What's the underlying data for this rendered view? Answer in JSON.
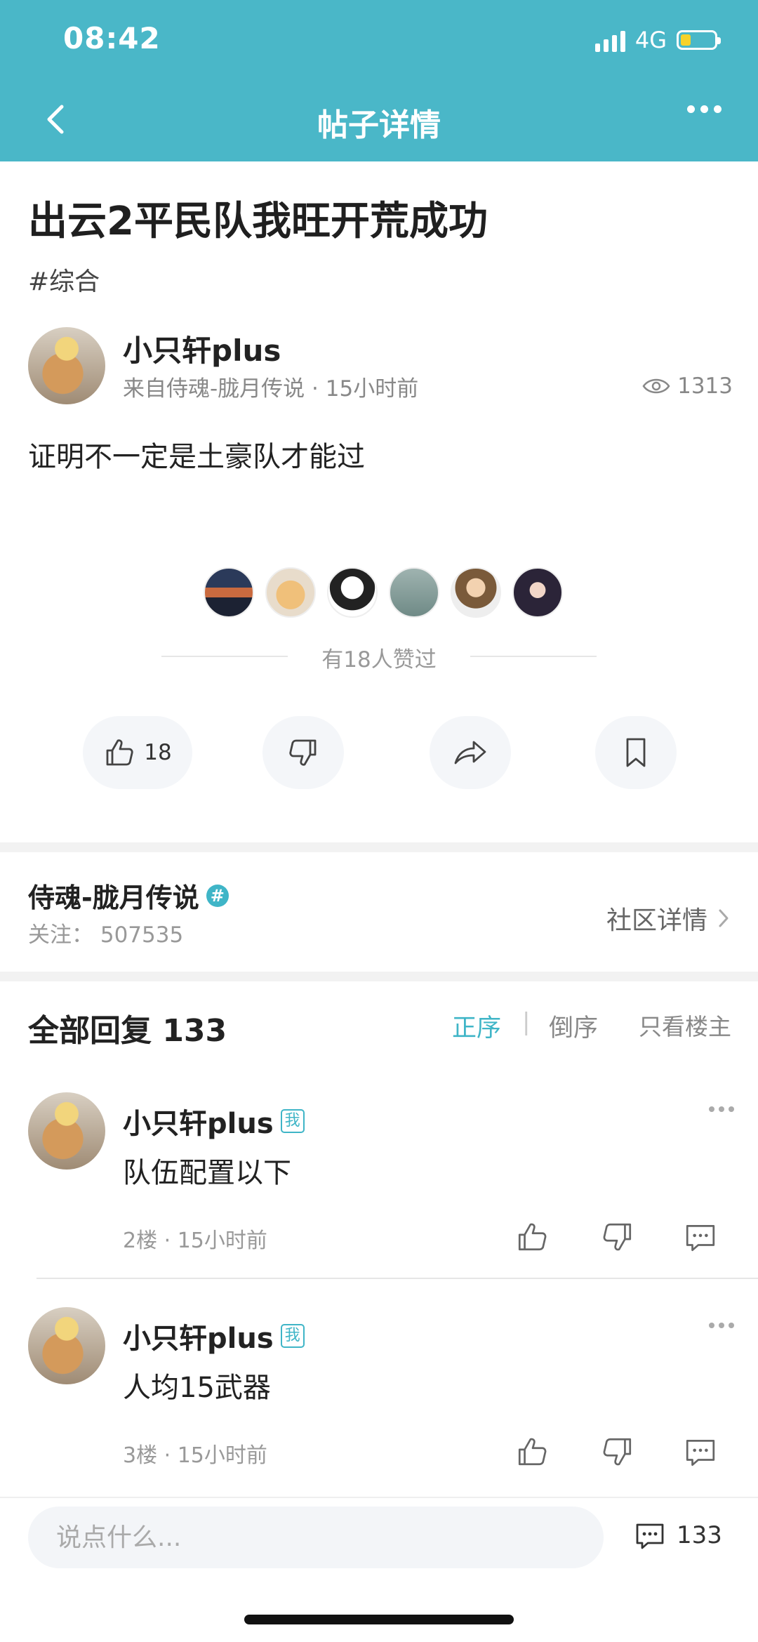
{
  "status_bar": {
    "time": "08:42",
    "network": "4G"
  },
  "nav": {
    "title": "帖子详情"
  },
  "post": {
    "title": "出云2平民队我旺开荒成功",
    "tag": "#综合",
    "author": "小只轩plus",
    "meta": "来自侍魂-胧月传说 · 15小时前",
    "views": "1313",
    "body": "证明不一定是土豪队才能过",
    "likers_text": "有18人赞过",
    "like_count": "18"
  },
  "community": {
    "name": "侍魂-胧月传说",
    "badge": "#",
    "followers": "关注：  507535",
    "detail_label": "社区详情"
  },
  "replies": {
    "title": "全部回复 133",
    "sort_asc": "正序",
    "sort_separator": "|",
    "sort_desc": "倒序",
    "owner_only": "只看楼主",
    "items": [
      {
        "author": "小只轩plus",
        "badge": "我",
        "text": "队伍配置以下",
        "meta": "2楼 · 15小时前"
      },
      {
        "author": "小只轩plus",
        "badge": "我",
        "text": "人均15武器",
        "meta": "3楼 · 15小时前"
      }
    ]
  },
  "bottom": {
    "input_placeholder": "说点什么...",
    "comment_count": "133"
  },
  "colors": {
    "header": "#4ab7c8",
    "accent": "#3fb5c7",
    "battery": "#f7d22a"
  },
  "icons": [
    "back-arrow-icon",
    "more-dots-icon",
    "eye-icon",
    "thumbs-up-icon",
    "thumbs-down-icon",
    "share-icon",
    "bookmark-icon",
    "chevron-right-icon",
    "comment-icon",
    "hash-badge-icon"
  ]
}
